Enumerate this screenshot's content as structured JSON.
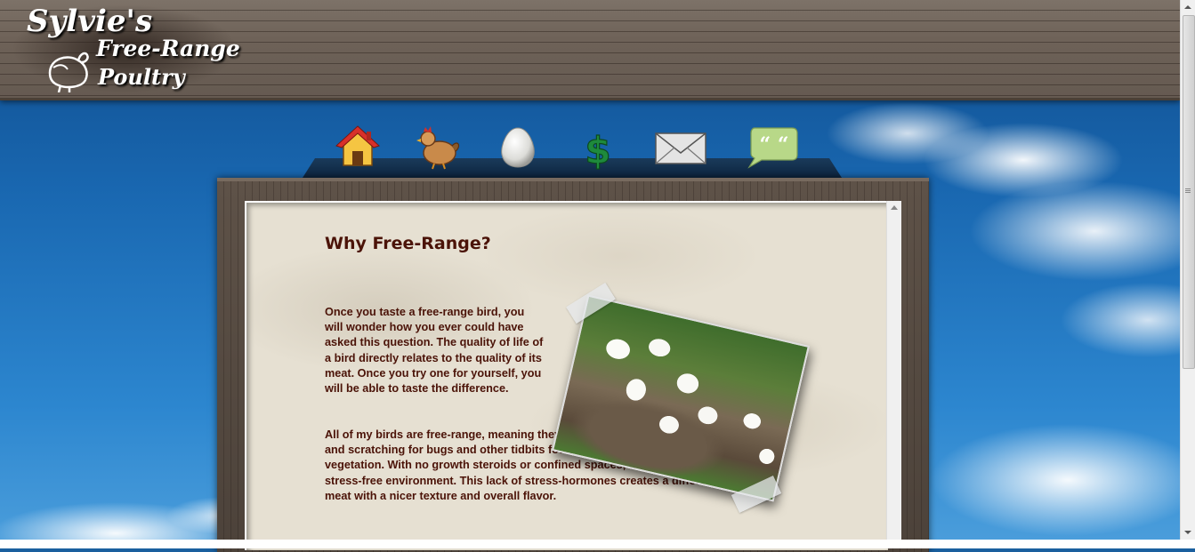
{
  "logo": {
    "line1": "Sylvie's",
    "line2": "Free-Range",
    "line3": "Poultry"
  },
  "nav": {
    "items": [
      {
        "icon": "house-icon"
      },
      {
        "icon": "chicken-icon"
      },
      {
        "icon": "egg-icon"
      },
      {
        "icon": "dollar-icon"
      },
      {
        "icon": "envelope-icon"
      },
      {
        "icon": "speech-bubble-icon"
      }
    ]
  },
  "content": {
    "heading": "Why Free-Range?",
    "paragraph1": "Once you taste a free-range bird, you will wonder how you ever could have asked this question. The quality of life of a bird directly relates to the quality of its meat. Once you try one for yourself, you will be able to taste the difference.",
    "paragraph2": "All of my birds are free-range, meaning they spend their days enjoying dust baths and scratching for bugs and other tidbits found outside, including sampling of vegetation. With no growth steroids or confined spaces, the birds experience a stress-free environment. This lack of stress-hormones creates a different kind of meat with a nicer texture and overall flavor."
  },
  "colors": {
    "text": "#4b1308",
    "paper": "#e6e0d2",
    "wood": "#6e6258",
    "sky": "#1967b0"
  }
}
